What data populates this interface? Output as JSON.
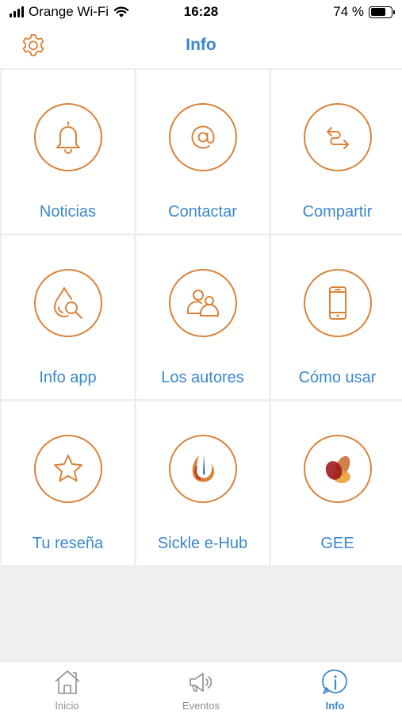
{
  "status_bar": {
    "carrier": "Orange Wi-Fi",
    "time": "16:28",
    "battery": "74 %",
    "battery_level": 0.74
  },
  "nav": {
    "title": "Info",
    "settings_icon": "gear-icon"
  },
  "tiles": [
    {
      "label": "Noticias",
      "icon": "bell-icon"
    },
    {
      "label": "Contactar",
      "icon": "at-sign-icon"
    },
    {
      "label": "Compartir",
      "icon": "share-arrows-icon"
    },
    {
      "label": "Info app",
      "icon": "drop-search-icon"
    },
    {
      "label": "Los autores",
      "icon": "people-icon"
    },
    {
      "label": "Cómo usar",
      "icon": "phone-icon"
    },
    {
      "label": "Tu reseña",
      "icon": "star-icon"
    },
    {
      "label": "Sickle e-Hub",
      "icon": "sickle-ehub-logo"
    },
    {
      "label": "GEE",
      "icon": "gee-logo"
    }
  ],
  "tab_bar": {
    "tabs": [
      {
        "label": "Inicio",
        "icon": "home-icon",
        "active": false
      },
      {
        "label": "Eventos",
        "icon": "megaphone-icon",
        "active": false
      },
      {
        "label": "Info",
        "icon": "info-icon",
        "active": true
      }
    ]
  },
  "colors": {
    "accent_orange": "#d9833a",
    "accent_blue": "#3a87cf",
    "inactive_gray": "#8e8e8e",
    "background": "#efefef"
  }
}
